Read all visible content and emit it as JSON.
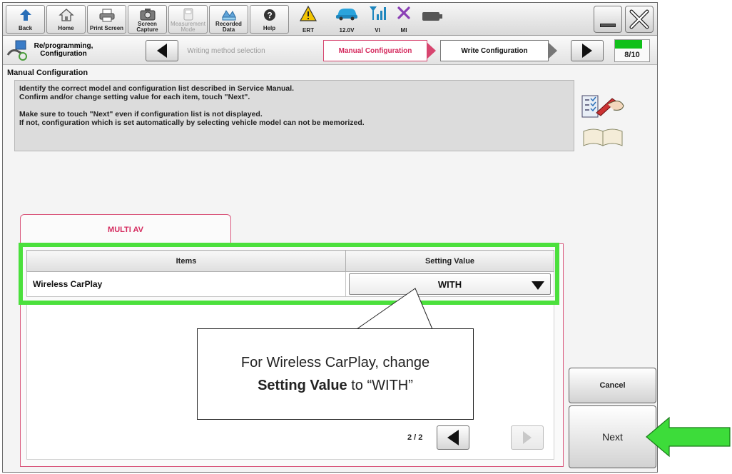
{
  "toolbar": {
    "back": "Back",
    "home": "Home",
    "print_screen": "Print Screen",
    "screen_capture": "Screen Capture",
    "measurement_mode": "Measurement Mode",
    "recorded_data": "Recorded Data",
    "help": "Help",
    "ert": "ERT",
    "voltage": "12.0V",
    "vi": "VI",
    "mi": "MI"
  },
  "stepbar": {
    "title": "Re/programming, Configuration",
    "step_prev": "Writing method selection",
    "step_current": "Manual Configuration",
    "step_next": "Write Configuration",
    "progress_text": "8/10",
    "progress_fraction": 0.8
  },
  "page": {
    "section_title": "Manual Configuration",
    "info_line1": "Identify the correct model and configuration list described in Service Manual.",
    "info_line2": "Confirm and/or change setting value for each item, touch \"Next\".",
    "info_line3": "Make sure to touch \"Next\" even if configuration list is not displayed.",
    "info_line4": "If not, configuration which is set automatically by selecting vehicle model can not be memorized."
  },
  "tab": {
    "label": "MULTI AV"
  },
  "table": {
    "headers": [
      "Items",
      "Setting Value"
    ],
    "rows": [
      {
        "item": "Wireless CarPlay",
        "value": "WITH"
      }
    ]
  },
  "pager": {
    "text": "2 / 2"
  },
  "buttons": {
    "cancel": "Cancel",
    "next": "Next"
  },
  "callout": {
    "line1": "For Wireless CarPlay, change",
    "bold": "Setting Value",
    "line2_rest": " to “WITH”"
  },
  "colors": {
    "highlight": "#4be03c",
    "accent_tab": "#d52a5e",
    "progress_fill": "#10c01a",
    "arrow": "#3ddc3a"
  }
}
